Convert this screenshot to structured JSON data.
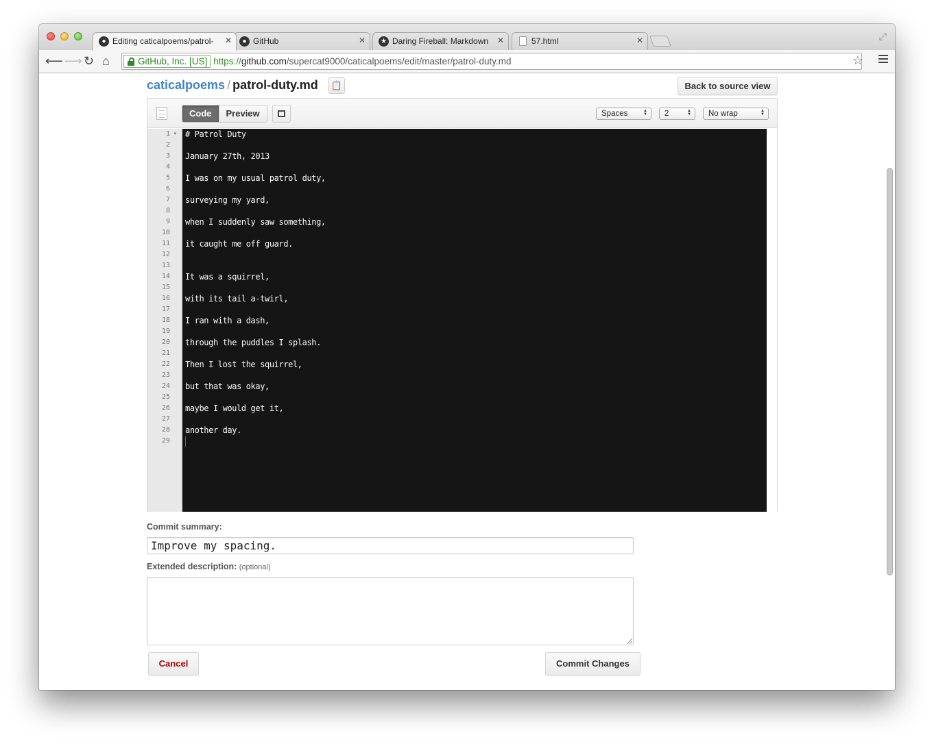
{
  "browser": {
    "tabs": [
      {
        "title": "Editing caticalpoems/patrol-",
        "icon": "github-icon",
        "active": true
      },
      {
        "title": "GitHub",
        "icon": "github-icon",
        "active": false
      },
      {
        "title": "Daring Fireball: Markdown S",
        "icon": "star-icon",
        "active": false
      },
      {
        "title": "57.html",
        "icon": "document-icon",
        "active": false
      }
    ],
    "ev_badge": "GitHub, Inc. [US]",
    "url_scheme": "https://",
    "url_host": "github.com",
    "url_path": "/supercat9000/caticalpoems/edit/master/patrol-duty.md"
  },
  "page": {
    "repo": "caticalpoems",
    "separator": "/",
    "filename": "patrol-duty.md",
    "back_button": "Back to source view"
  },
  "editor": {
    "tabs": {
      "code": "Code",
      "preview": "Preview"
    },
    "indent_mode": "Spaces",
    "indent_size": "2",
    "wrap_mode": "No wrap",
    "lines": [
      "# Patrol Duty",
      "",
      "January 27th, 2013",
      "",
      "I was on my usual patrol duty,",
      "",
      "surveying my yard,",
      "",
      "when I suddenly saw something,",
      "",
      "it caught me off guard.",
      "",
      "",
      "It was a squirrel,",
      "",
      "with its tail a-twirl,",
      "",
      "I ran with a dash,",
      "",
      "through the puddles I splash.",
      "",
      "Then I lost the squirrel,",
      "",
      "but that was okay,",
      "",
      "maybe I would get it,",
      "",
      "another day.",
      ""
    ]
  },
  "commit": {
    "summary_label": "Commit summary:",
    "summary_value": "Improve my spacing.",
    "description_label": "Extended description:",
    "description_optional": "(optional)",
    "description_value": "",
    "cancel_button": "Cancel",
    "commit_button": "Commit Changes"
  },
  "colors": {
    "link": "#4183c4",
    "editor_bg": "#151515",
    "cancel_text": "#aa0000"
  }
}
